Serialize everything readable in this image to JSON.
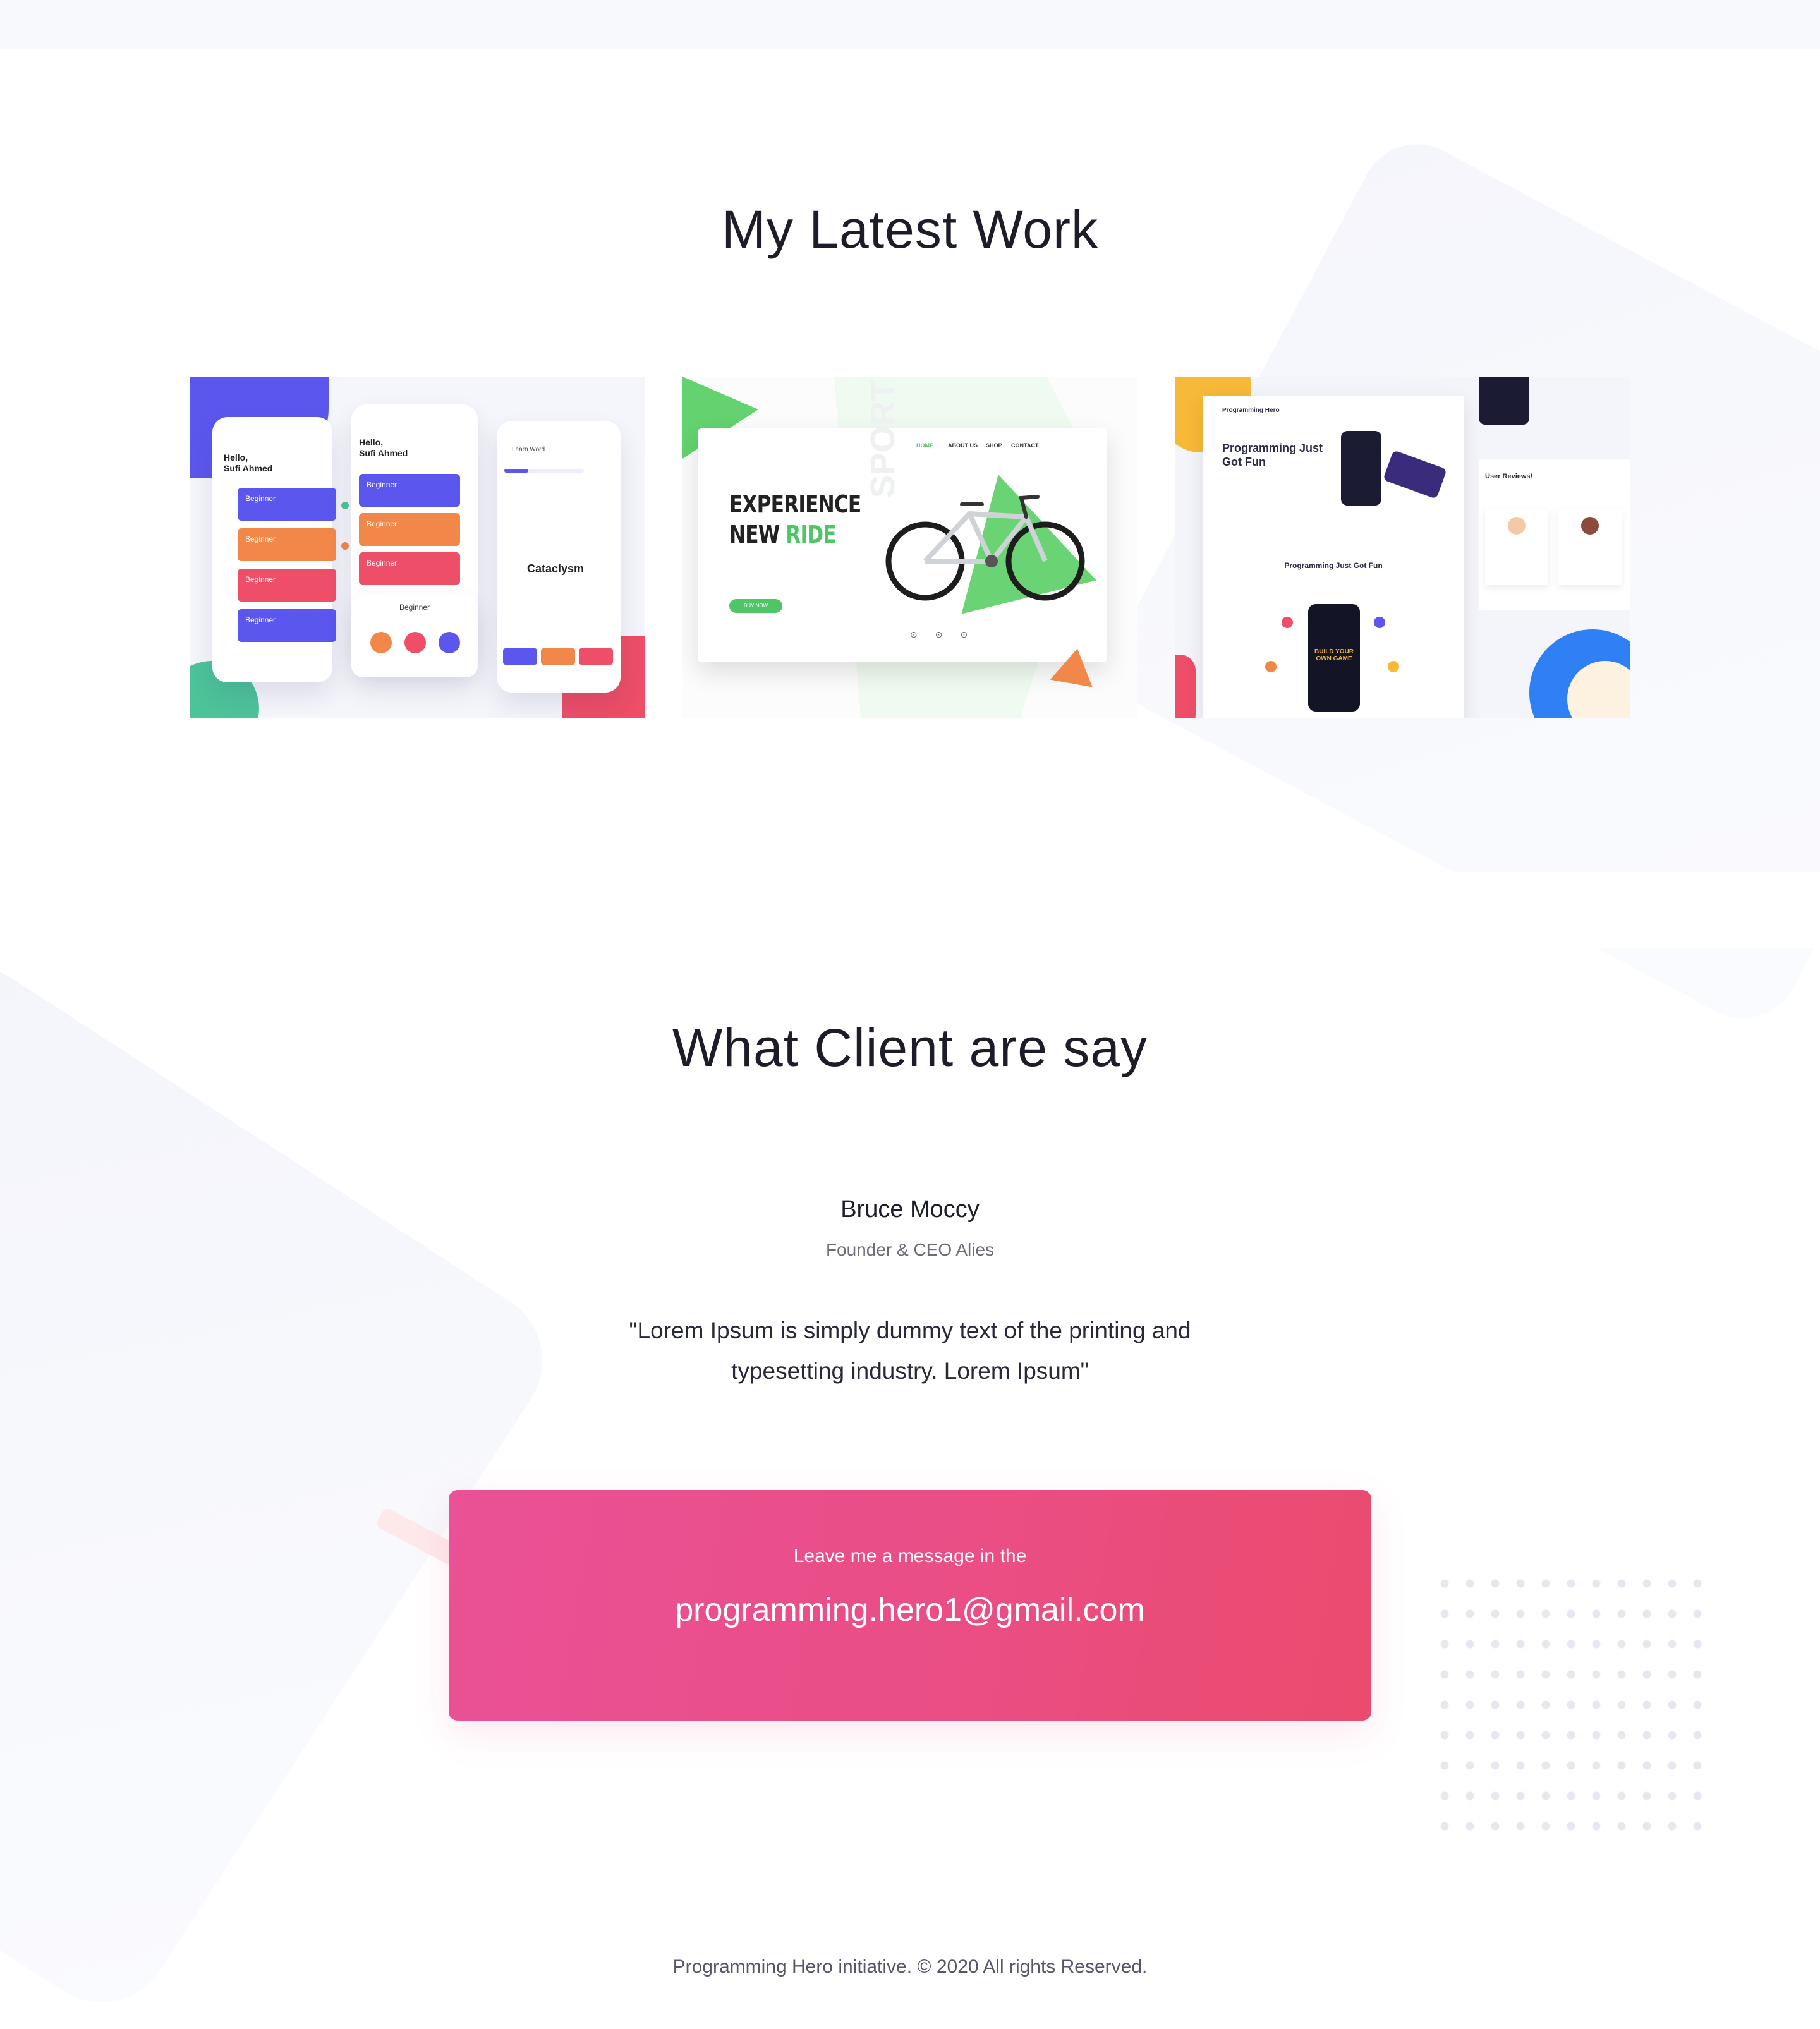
{
  "work": {
    "title": "My Latest Work",
    "cards": [
      {
        "hello_a": "Hello,",
        "name_a": "Sufi Ahmed",
        "hello_b": "Hello,",
        "name_b": "Sufi Ahmed",
        "learn": "Learn Word",
        "word": "Cataclysm",
        "level": "Beginner",
        "pills": [
          "Beginner",
          "Beginner",
          "Beginner",
          "Beginner"
        ],
        "pills_b": [
          "Beginner",
          "Beginner",
          "Beginner"
        ]
      },
      {
        "nav": [
          "HOME",
          "ABOUT US",
          "SHOP",
          "CONTACT"
        ],
        "headline_a": "EXPERIENCE",
        "headline_b1": "NEW ",
        "headline_b2": "RIDE",
        "sport": "SPORT",
        "buy": "BUY NOW"
      },
      {
        "brand": "Programming Hero",
        "hero_title": "Programming Just Got Fun",
        "section": "Programming Just Got Fun",
        "reviews": "User Reviews!",
        "game": "BUILD YOUR OWN GAME"
      }
    ]
  },
  "testimonial": {
    "title": "What Client are say",
    "name": "Bruce Moccy",
    "role": "Founder & CEO Alies",
    "quote": "\"Lorem Ipsum is simply dummy text of the printing and typesetting industry. Lorem Ipsum\""
  },
  "contact": {
    "lead": "Leave me a message in the",
    "email": "programming.hero1@gmail.com"
  },
  "footer": {
    "text": "Programming Hero initiative. © 2020 All rights Reserved."
  },
  "colors": {
    "accent_pink": "#ea4e87",
    "purple": "#5b57ee",
    "orange": "#f2874a",
    "red": "#ee4e67",
    "green": "#4fc666"
  }
}
